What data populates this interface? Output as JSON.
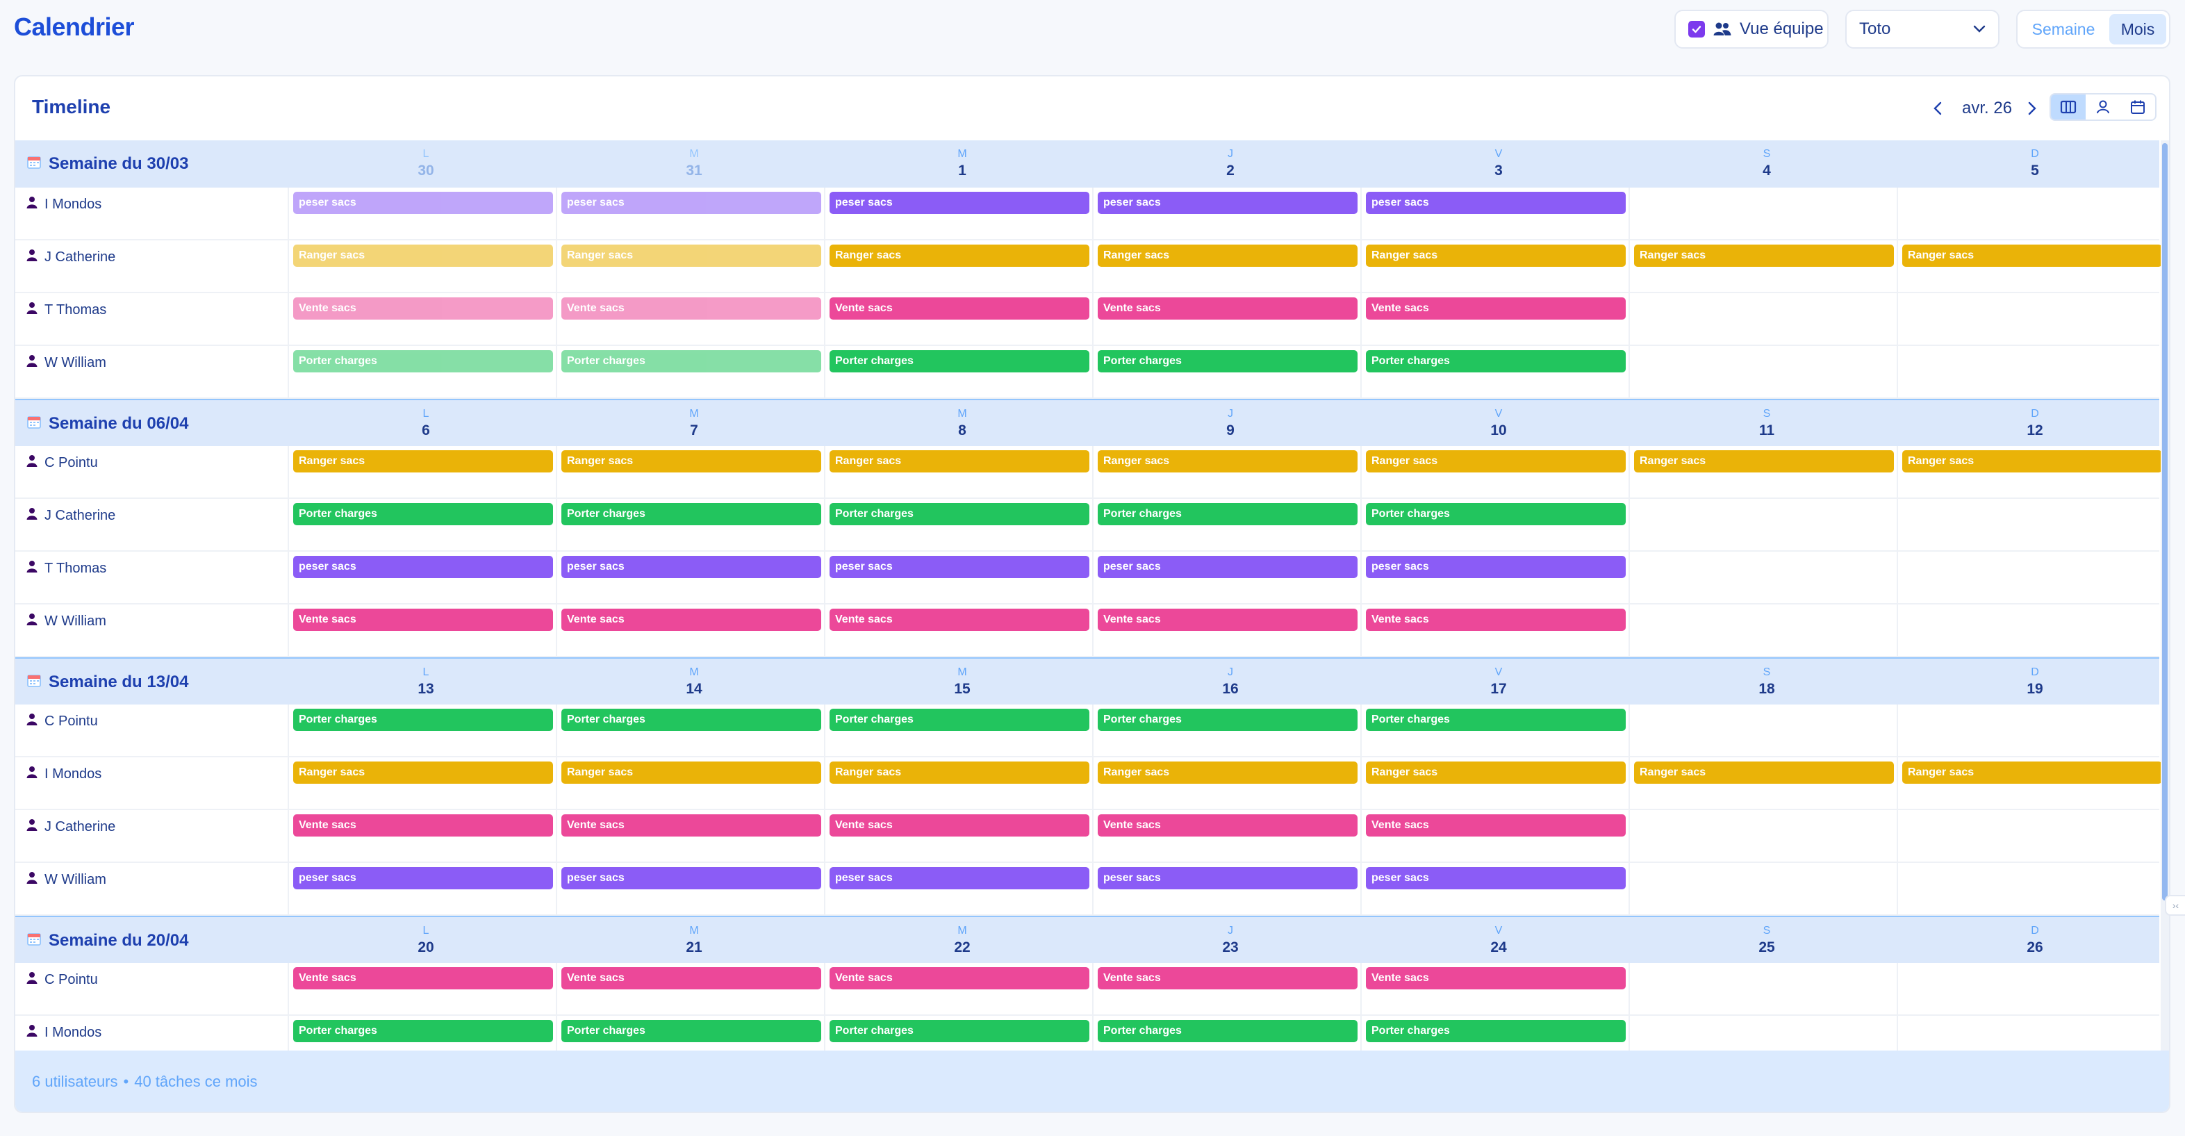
{
  "app": {
    "title": "Calendrier"
  },
  "toolbar": {
    "team_view_label": "Vue équipe",
    "team_view_checked": true,
    "user_select_value": "Toto",
    "view_options": [
      "Semaine",
      "Mois"
    ],
    "active_view": "Mois"
  },
  "panel": {
    "title": "Timeline",
    "month_label": "avr. 26",
    "layout_buttons": [
      "columns-icon",
      "user-icon",
      "calendar-icon"
    ],
    "active_layout": "columns-icon"
  },
  "colors": {
    "accent": "#1d4ed8",
    "peser sacs": "#8b5cf6",
    "Ranger sacs": "#eab308",
    "Vente sacs": "#ec4899",
    "Porter charges": "#22c55e"
  },
  "day_letters": [
    "L",
    "M",
    "M",
    "J",
    "V",
    "S",
    "D"
  ],
  "weeks": [
    {
      "label": "Semaine du 30/03",
      "days": [
        "30",
        "31",
        "1",
        "2",
        "3",
        "4",
        "5"
      ],
      "past_days": [
        0,
        1
      ],
      "rows": [
        {
          "user": "I Mondos",
          "tasks": [
            "peser sacs",
            "peser sacs",
            "peser sacs",
            "peser sacs",
            "peser sacs",
            "",
            ""
          ]
        },
        {
          "user": "J Catherine",
          "tasks": [
            "Ranger sacs",
            "Ranger sacs",
            "Ranger sacs",
            "Ranger sacs",
            "Ranger sacs",
            "Ranger sacs",
            "Ranger sacs"
          ]
        },
        {
          "user": "T Thomas",
          "tasks": [
            "Vente sacs",
            "Vente sacs",
            "Vente sacs",
            "Vente sacs",
            "Vente sacs",
            "",
            ""
          ]
        },
        {
          "user": "W William",
          "tasks": [
            "Porter charges",
            "Porter charges",
            "Porter charges",
            "Porter charges",
            "Porter charges",
            "",
            ""
          ]
        }
      ]
    },
    {
      "label": "Semaine du 06/04",
      "days": [
        "6",
        "7",
        "8",
        "9",
        "10",
        "11",
        "12"
      ],
      "past_days": [],
      "rows": [
        {
          "user": "C Pointu",
          "tasks": [
            "Ranger sacs",
            "Ranger sacs",
            "Ranger sacs",
            "Ranger sacs",
            "Ranger sacs",
            "Ranger sacs",
            "Ranger sacs"
          ]
        },
        {
          "user": "J Catherine",
          "tasks": [
            "Porter charges",
            "Porter charges",
            "Porter charges",
            "Porter charges",
            "Porter charges",
            "",
            ""
          ]
        },
        {
          "user": "T Thomas",
          "tasks": [
            "peser sacs",
            "peser sacs",
            "peser sacs",
            "peser sacs",
            "peser sacs",
            "",
            ""
          ]
        },
        {
          "user": "W William",
          "tasks": [
            "Vente sacs",
            "Vente sacs",
            "Vente sacs",
            "Vente sacs",
            "Vente sacs",
            "",
            ""
          ]
        }
      ]
    },
    {
      "label": "Semaine du 13/04",
      "days": [
        "13",
        "14",
        "15",
        "16",
        "17",
        "18",
        "19"
      ],
      "past_days": [],
      "rows": [
        {
          "user": "C Pointu",
          "tasks": [
            "Porter charges",
            "Porter charges",
            "Porter charges",
            "Porter charges",
            "Porter charges",
            "",
            ""
          ]
        },
        {
          "user": "I Mondos",
          "tasks": [
            "Ranger sacs",
            "Ranger sacs",
            "Ranger sacs",
            "Ranger sacs",
            "Ranger sacs",
            "Ranger sacs",
            "Ranger sacs"
          ]
        },
        {
          "user": "J Catherine",
          "tasks": [
            "Vente sacs",
            "Vente sacs",
            "Vente sacs",
            "Vente sacs",
            "Vente sacs",
            "",
            ""
          ]
        },
        {
          "user": "W William",
          "tasks": [
            "peser sacs",
            "peser sacs",
            "peser sacs",
            "peser sacs",
            "peser sacs",
            "",
            ""
          ]
        }
      ]
    },
    {
      "label": "Semaine du 20/04",
      "days": [
        "20",
        "21",
        "22",
        "23",
        "24",
        "25",
        "26"
      ],
      "past_days": [],
      "rows": [
        {
          "user": "C Pointu",
          "tasks": [
            "Vente sacs",
            "Vente sacs",
            "Vente sacs",
            "Vente sacs",
            "Vente sacs",
            "",
            ""
          ]
        },
        {
          "user": "I Mondos",
          "tasks": [
            "Porter charges",
            "Porter charges",
            "Porter charges",
            "Porter charges",
            "Porter charges",
            "",
            ""
          ]
        }
      ]
    }
  ],
  "footer": {
    "users_count": "6 utilisateurs",
    "separator": "•",
    "tasks_count": "40 tâches ce mois"
  },
  "side_grip": "›‹"
}
